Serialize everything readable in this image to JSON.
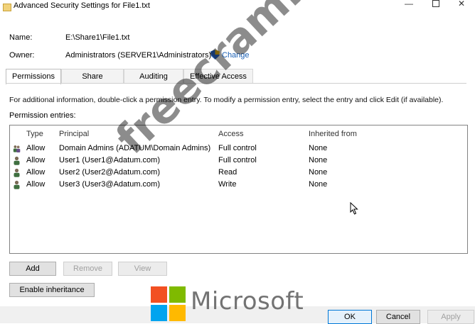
{
  "window": {
    "title": "Advanced Security Settings for File1.txt",
    "minimize_glyph": "—",
    "close_glyph": "✕"
  },
  "fields": {
    "name_label": "Name:",
    "name_value": "E:\\Share1\\File1.txt",
    "owner_label": "Owner:",
    "owner_value": "Administrators (SERVER1\\Administrators)",
    "change_label": "Change"
  },
  "tabs": [
    {
      "label": "Permissions",
      "active": true
    },
    {
      "label": "Share",
      "active": false
    },
    {
      "label": "Auditing",
      "active": false
    },
    {
      "label": "Effective Access",
      "active": false
    }
  ],
  "permissions": {
    "info_text": "For additional information, double-click a permission entry. To modify a permission entry, select the entry and click Edit (if available).",
    "entries_label": "Permission entries:",
    "columns": [
      "Type",
      "Principal",
      "Access",
      "Inherited from"
    ],
    "rows": [
      {
        "icon": "group-icon",
        "type": "Allow",
        "principal": "Domain Admins (ADATUM\\Domain Admins)",
        "access": "Full control",
        "inherited": "None"
      },
      {
        "icon": "user-icon",
        "type": "Allow",
        "principal": "User1 (User1@Adatum.com)",
        "access": "Full control",
        "inherited": "None"
      },
      {
        "icon": "user-icon",
        "type": "Allow",
        "principal": "User2 (User2@Adatum.com)",
        "access": "Read",
        "inherited": "None"
      },
      {
        "icon": "user-icon",
        "type": "Allow",
        "principal": "User3 (User3@Adatum.com)",
        "access": "Write",
        "inherited": "None"
      }
    ]
  },
  "buttons": {
    "add": "Add",
    "remove": "Remove",
    "view": "View",
    "enable_inheritance": "Enable inheritance",
    "ok": "OK",
    "cancel": "Cancel",
    "apply": "Apply"
  },
  "overlay": {
    "watermark": "freecram.net",
    "logo_text": "Microsoft",
    "logo_colors": [
      "#f25022",
      "#7fba00",
      "#00a4ef",
      "#ffb900"
    ]
  }
}
